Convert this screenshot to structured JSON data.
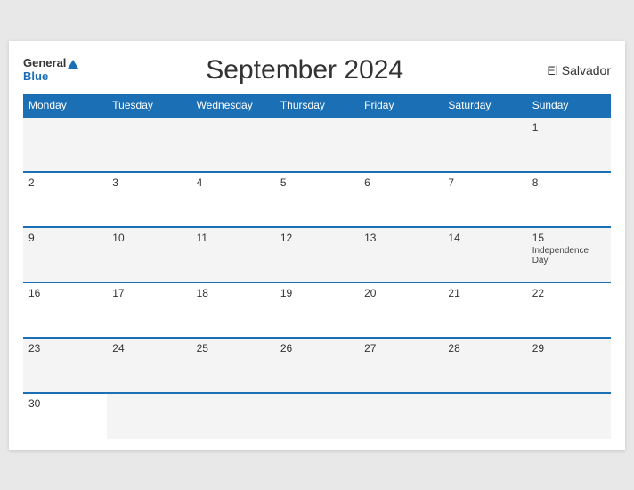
{
  "header": {
    "logo_general": "General",
    "logo_blue": "Blue",
    "title": "September 2024",
    "country": "El Salvador"
  },
  "weekdays": [
    "Monday",
    "Tuesday",
    "Wednesday",
    "Thursday",
    "Friday",
    "Saturday",
    "Sunday"
  ],
  "weeks": [
    [
      {
        "day": "",
        "empty": true
      },
      {
        "day": "",
        "empty": true
      },
      {
        "day": "",
        "empty": true
      },
      {
        "day": "",
        "empty": true
      },
      {
        "day": "",
        "empty": true
      },
      {
        "day": "",
        "empty": true
      },
      {
        "day": "1",
        "event": ""
      }
    ],
    [
      {
        "day": "2",
        "event": ""
      },
      {
        "day": "3",
        "event": ""
      },
      {
        "day": "4",
        "event": ""
      },
      {
        "day": "5",
        "event": ""
      },
      {
        "day": "6",
        "event": ""
      },
      {
        "day": "7",
        "event": ""
      },
      {
        "day": "8",
        "event": ""
      }
    ],
    [
      {
        "day": "9",
        "event": ""
      },
      {
        "day": "10",
        "event": ""
      },
      {
        "day": "11",
        "event": ""
      },
      {
        "day": "12",
        "event": ""
      },
      {
        "day": "13",
        "event": ""
      },
      {
        "day": "14",
        "event": ""
      },
      {
        "day": "15",
        "event": "Independence Day"
      }
    ],
    [
      {
        "day": "16",
        "event": ""
      },
      {
        "day": "17",
        "event": ""
      },
      {
        "day": "18",
        "event": ""
      },
      {
        "day": "19",
        "event": ""
      },
      {
        "day": "20",
        "event": ""
      },
      {
        "day": "21",
        "event": ""
      },
      {
        "day": "22",
        "event": ""
      }
    ],
    [
      {
        "day": "23",
        "event": ""
      },
      {
        "day": "24",
        "event": ""
      },
      {
        "day": "25",
        "event": ""
      },
      {
        "day": "26",
        "event": ""
      },
      {
        "day": "27",
        "event": ""
      },
      {
        "day": "28",
        "event": ""
      },
      {
        "day": "29",
        "event": ""
      }
    ],
    [
      {
        "day": "30",
        "event": ""
      },
      {
        "day": "",
        "empty": true
      },
      {
        "day": "",
        "empty": true
      },
      {
        "day": "",
        "empty": true
      },
      {
        "day": "",
        "empty": true
      },
      {
        "day": "",
        "empty": true
      },
      {
        "day": "",
        "empty": true
      }
    ]
  ]
}
